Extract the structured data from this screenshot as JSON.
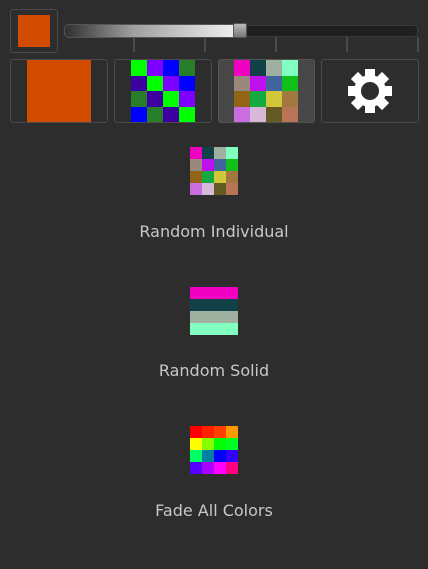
{
  "current_color": "#d24c00",
  "slider": {
    "value_percent": 50
  },
  "modes": [
    {
      "name": "solid",
      "selected": false
    },
    {
      "name": "checker",
      "selected": false,
      "colors": [
        [
          "#00ff00",
          "#8000ff",
          "#0000ff",
          "#287d28"
        ],
        [
          "#3c00a0",
          "#00ff00",
          "#8000ff",
          "#0000ff"
        ],
        [
          "#287d28",
          "#3c00a0",
          "#00ff00",
          "#8000ff"
        ],
        [
          "#0000ff",
          "#287d28",
          "#3c00a0",
          "#00ff00"
        ]
      ]
    },
    {
      "name": "random",
      "selected": true
    },
    {
      "name": "settings",
      "selected": false,
      "icon": "gear-icon"
    }
  ],
  "random_individual": {
    "label": "Random Individual",
    "colors": [
      [
        "#f000c0",
        "#104048",
        "#a0b0a0",
        "#80ffc0"
      ],
      [
        "#9a887c",
        "#c010f0",
        "#40649c",
        "#10c018"
      ],
      [
        "#926418",
        "#14aa40",
        "#d0c838",
        "#a07840"
      ],
      [
        "#c86ee0",
        "#d8b8d8",
        "#645a24",
        "#b87454"
      ]
    ]
  },
  "random_solid": {
    "label": "Random Solid",
    "colors": [
      "#f000c0",
      "#104048",
      "#a0b0a0",
      "#80ffc0"
    ]
  },
  "fade_all": {
    "label": "Fade All Colors",
    "colors": [
      [
        "#ff0000",
        "#ff2000",
        "#ff4000",
        "#ff9900"
      ],
      [
        "#ffff00",
        "#88ff00",
        "#00ff00",
        "#00ff22"
      ],
      [
        "#00ff66",
        "#0080a0",
        "#0000ff",
        "#3300ff"
      ],
      [
        "#5500ff",
        "#aa00ff",
        "#ff00ff",
        "#ff0080"
      ]
    ]
  }
}
